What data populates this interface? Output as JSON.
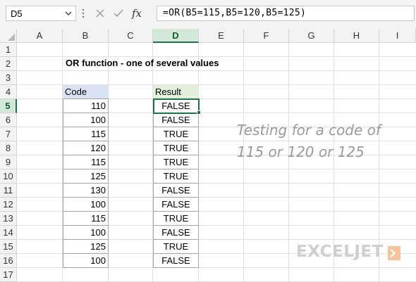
{
  "name_box": {
    "value": "D5"
  },
  "formula_bar": {
    "formula": "=OR(B5=115,B5=120,B5=125)",
    "fx_label": "fx"
  },
  "columns": [
    "A",
    "B",
    "C",
    "D",
    "E",
    "F",
    "G",
    "H",
    "I"
  ],
  "selected_column": "D",
  "rows": [
    "1",
    "2",
    "3",
    "4",
    "5",
    "6",
    "7",
    "8",
    "9",
    "10",
    "11",
    "12",
    "13",
    "14",
    "15",
    "16",
    "17"
  ],
  "selected_row": "5",
  "sheet": {
    "title": "OR function - one of several values",
    "code_header": "Code",
    "result_header": "Result",
    "codes": [
      "110",
      "100",
      "115",
      "120",
      "115",
      "125",
      "130",
      "100",
      "115",
      "100",
      "125",
      "100"
    ],
    "results": [
      "FALSE",
      "FALSE",
      "TRUE",
      "TRUE",
      "TRUE",
      "TRUE",
      "FALSE",
      "FALSE",
      "TRUE",
      "FALSE",
      "TRUE",
      "FALSE"
    ]
  },
  "note": {
    "line1": "Testing for a code of",
    "line2": "115 or 120 or 125"
  },
  "logo": {
    "text": "EXCELJET",
    "color": "#cfcfcf",
    "accent": "#f5c49a"
  },
  "colors": {
    "header_fill_code": "#dae3f3",
    "header_fill_result": "#e2efda",
    "selection": "#217346",
    "table_border": "#a6a6a6"
  }
}
